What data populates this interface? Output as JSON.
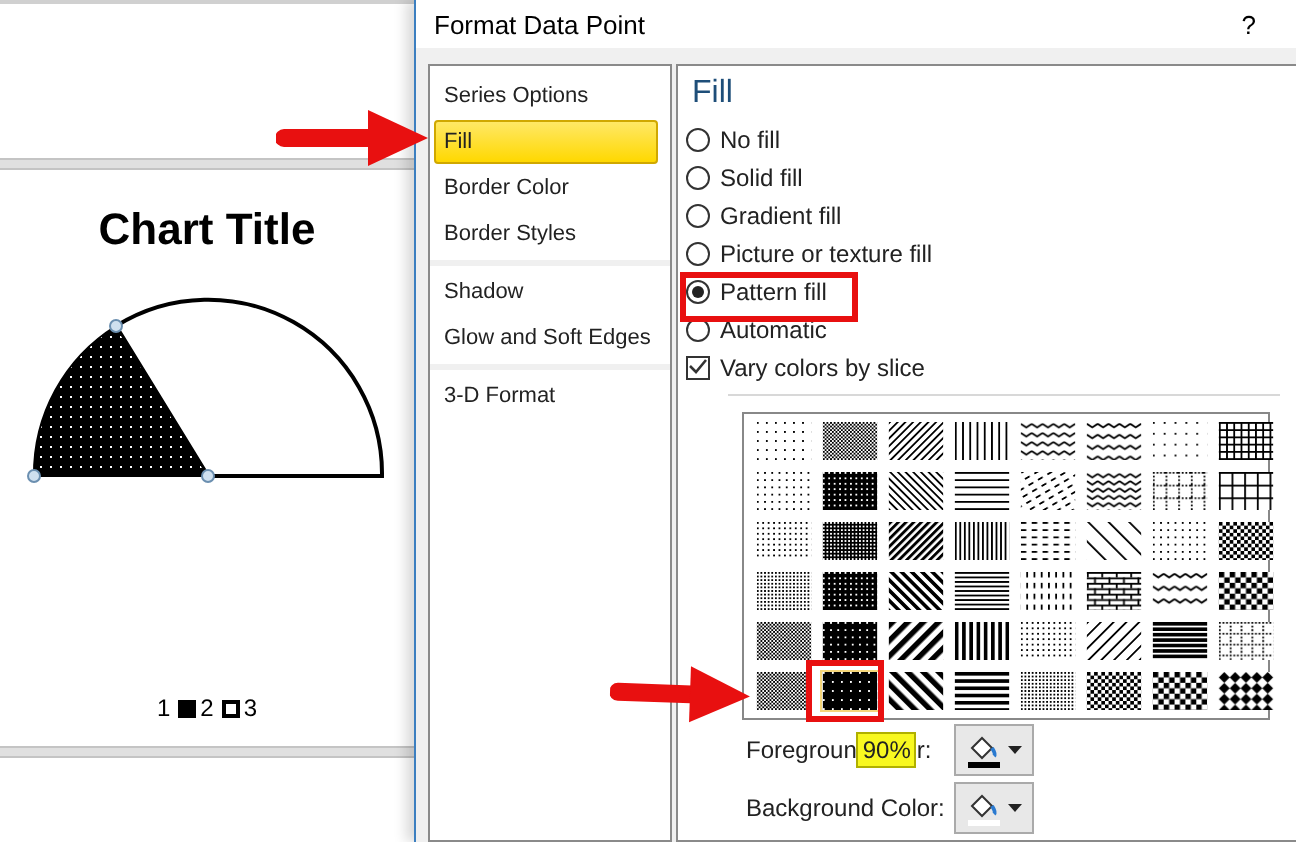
{
  "chart": {
    "title": "Chart Title",
    "legend": [
      {
        "label": "1",
        "kind": "none"
      },
      {
        "label": "2",
        "kind": "pattern"
      },
      {
        "label": "3",
        "kind": "outline"
      }
    ]
  },
  "dialog": {
    "title": "Format Data Point",
    "help": "?",
    "nav_groups": [
      [
        {
          "label": "Series Options",
          "selected": false
        },
        {
          "label": "Fill",
          "selected": true
        },
        {
          "label": "Border Color",
          "selected": false
        },
        {
          "label": "Border Styles",
          "selected": false
        }
      ],
      [
        {
          "label": "Shadow",
          "selected": false
        },
        {
          "label": "Glow and Soft Edges",
          "selected": false
        }
      ],
      [
        {
          "label": "3-D Format",
          "selected": false
        }
      ]
    ],
    "fill": {
      "heading": "Fill",
      "options": [
        {
          "label": "No fill",
          "selected": false
        },
        {
          "label": "Solid fill",
          "selected": false
        },
        {
          "label": "Gradient fill",
          "selected": false
        },
        {
          "label": "Picture or texture fill",
          "selected": false
        },
        {
          "label": "Pattern fill",
          "selected": true
        },
        {
          "label": "Automatic",
          "selected": false
        }
      ],
      "vary_colors": {
        "label": "Vary colors by slice",
        "checked": true
      },
      "patterns": [
        {
          "selected": false
        },
        {
          "selected": false
        },
        {
          "selected": false
        },
        {
          "selected": false
        },
        {
          "selected": false
        },
        {
          "selected": false
        },
        {
          "selected": false
        },
        {
          "selected": false
        },
        {
          "selected": false
        },
        {
          "selected": false
        },
        {
          "selected": false
        },
        {
          "selected": false
        },
        {
          "selected": false
        },
        {
          "selected": false
        },
        {
          "selected": false
        },
        {
          "selected": false
        },
        {
          "selected": false
        },
        {
          "selected": false
        },
        {
          "selected": false
        },
        {
          "selected": false
        },
        {
          "selected": false
        },
        {
          "selected": false
        },
        {
          "selected": false
        },
        {
          "selected": false
        },
        {
          "selected": false
        },
        {
          "selected": false
        },
        {
          "selected": false
        },
        {
          "selected": false
        },
        {
          "selected": false
        },
        {
          "selected": false
        },
        {
          "selected": false
        },
        {
          "selected": false
        },
        {
          "selected": false
        },
        {
          "selected": false
        },
        {
          "selected": false
        },
        {
          "selected": false
        },
        {
          "selected": false
        },
        {
          "selected": false
        },
        {
          "selected": false
        },
        {
          "selected": false
        },
        {
          "selected": false
        },
        {
          "selected": true
        },
        {
          "selected": false
        },
        {
          "selected": false
        },
        {
          "selected": false
        },
        {
          "selected": false
        },
        {
          "selected": false
        },
        {
          "selected": false
        }
      ],
      "foreground": {
        "label_start": "Foregroun",
        "tooltip": "90%",
        "label_end": "r:"
      },
      "background": {
        "label": "Background Color:"
      }
    }
  }
}
